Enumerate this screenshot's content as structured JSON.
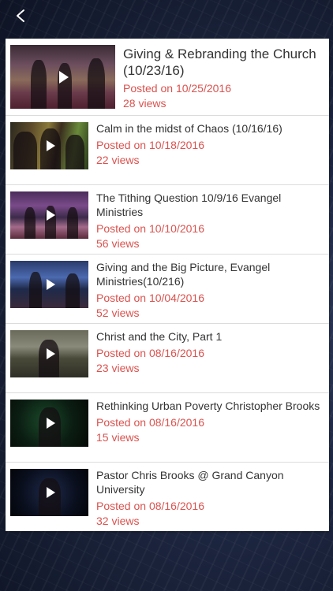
{
  "colors": {
    "accent": "#d9534f",
    "title_text": "#333333",
    "panel": "#ffffff"
  },
  "header": {
    "back_icon": "chevron-left-icon"
  },
  "videos": [
    {
      "title": "Giving & Rebranding the Church (10/23/16)",
      "posted": "Posted on 10/25/2016",
      "views": "28 views"
    },
    {
      "title": "Calm in the midst of Chaos (10/16/16)",
      "posted": "Posted on 10/18/2016",
      "views": "22 views"
    },
    {
      "title": "The Tithing Question 10/9/16 Evangel Ministries",
      "posted": "Posted on 10/10/2016",
      "views": "56 views"
    },
    {
      "title": "Giving and the Big Picture, Evangel Ministries(10/216)",
      "posted": "Posted on 10/04/2016",
      "views": "52 views"
    },
    {
      "title": "Christ and the City, Part 1",
      "posted": "Posted on 08/16/2016",
      "views": "23 views"
    },
    {
      "title": "Rethinking Urban Poverty Christopher Brooks",
      "posted": "Posted on 08/16/2016",
      "views": "15 views"
    },
    {
      "title": "Pastor Chris Brooks @ Grand Canyon University",
      "posted": "Posted on 08/16/2016",
      "views": "32 views"
    }
  ]
}
